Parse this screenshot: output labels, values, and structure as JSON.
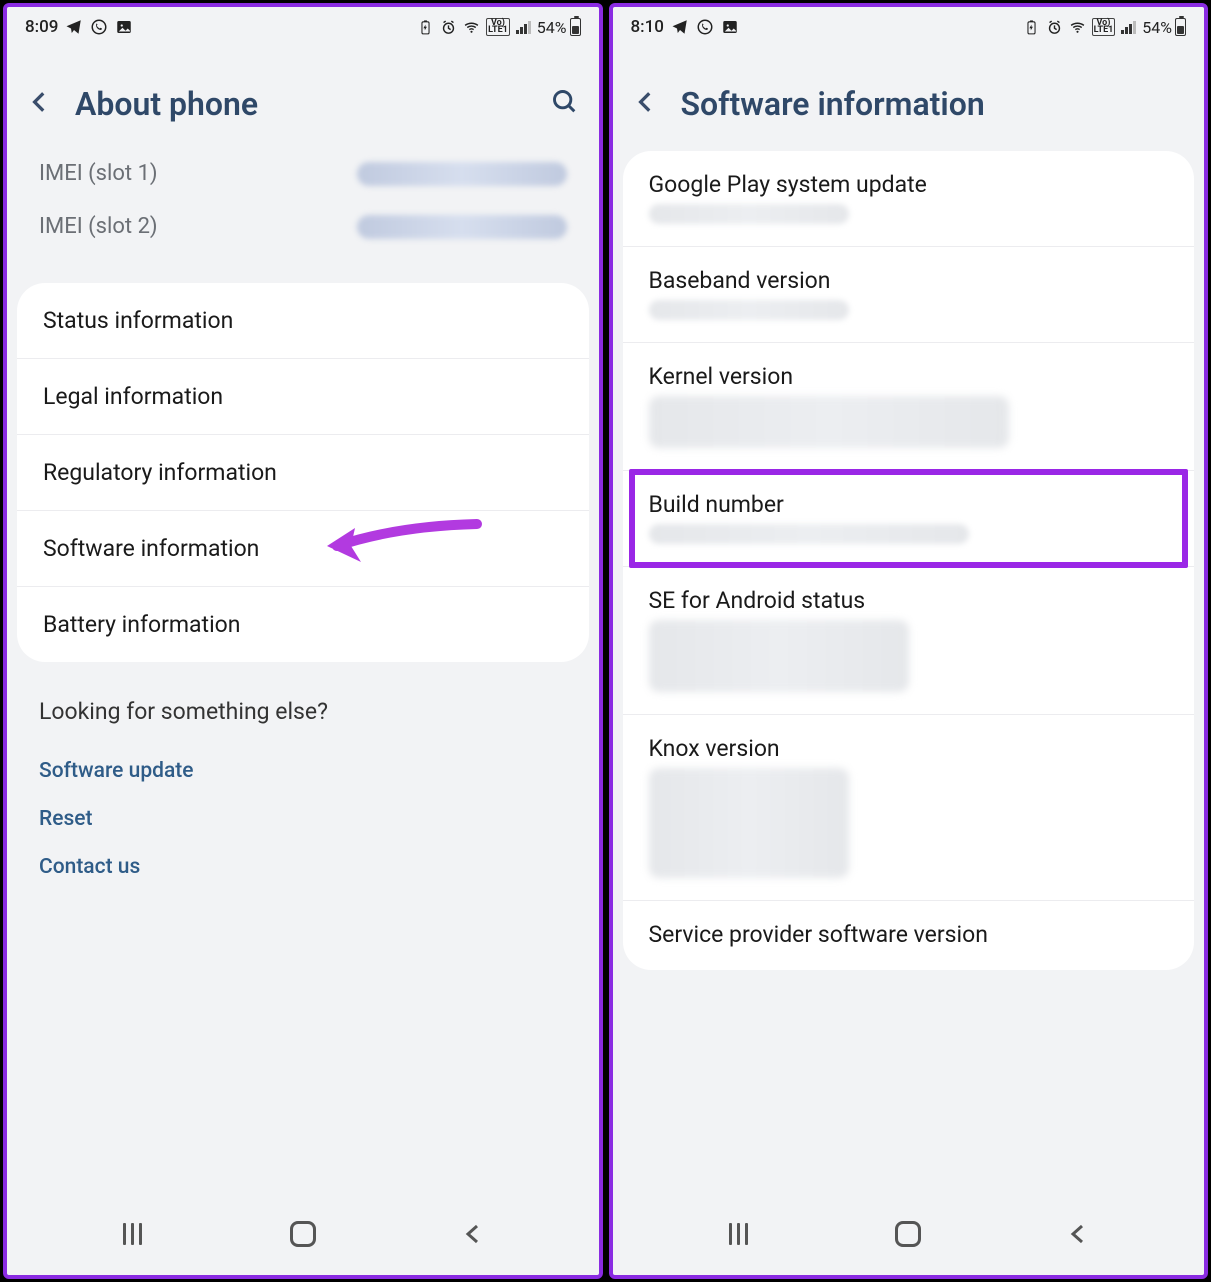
{
  "left": {
    "statusbar": {
      "time": "8:09",
      "battery_pct": "54%"
    },
    "header": {
      "title": "About phone"
    },
    "imei": {
      "slot1_label": "IMEI (slot 1)",
      "slot2_label": "IMEI (slot 2)"
    },
    "items": [
      "Status information",
      "Legal information",
      "Regulatory information",
      "Software information",
      "Battery information"
    ],
    "looking": {
      "heading": "Looking for something else?",
      "links": [
        "Software update",
        "Reset",
        "Contact us"
      ]
    }
  },
  "right": {
    "statusbar": {
      "time": "8:10",
      "battery_pct": "54%"
    },
    "header": {
      "title": "Software information"
    },
    "items": [
      "Google Play system update",
      "Baseband version",
      "Kernel version",
      "Build number",
      "SE for Android status",
      "Knox version",
      "Service provider software version"
    ]
  },
  "annotations": {
    "arrow_target_index": 3,
    "highlight_target_index": 3,
    "arrow_color": "#b23ae0",
    "highlight_color": "#9a27e6"
  }
}
